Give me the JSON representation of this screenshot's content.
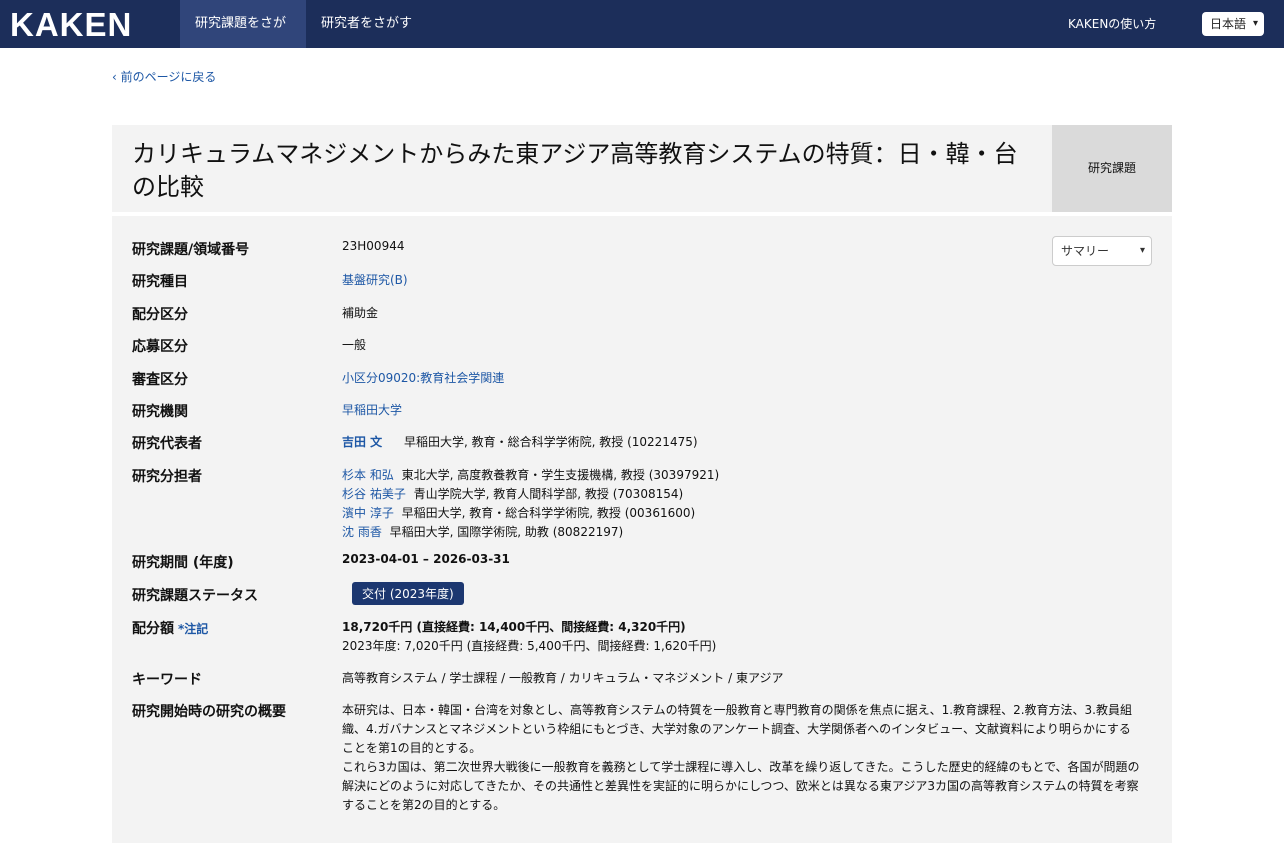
{
  "nav": {
    "logo": "KAKEN",
    "tab_projects": "研究課題をさがす",
    "tab_researchers": "研究者をさがす",
    "help": "KAKENの使い方",
    "language": "日本語"
  },
  "back_link": "前のページに戻る",
  "project": {
    "title": "カリキュラムマネジメントからみた東アジア高等教育システムの特質：日・韓・台の比較",
    "type_label": "研究課題",
    "summary_select": "サマリー"
  },
  "fields": {
    "number_label": "研究課題/領域番号",
    "number_value": "23H00944",
    "category_label": "研究種目",
    "category_value": "基盤研究(B)",
    "allocation_label": "配分区分",
    "allocation_value": "補助金",
    "application_label": "応募区分",
    "application_value": "一般",
    "review_label": "審査区分",
    "review_value": "小区分09020:教育社会学関連",
    "institution_label": "研究機関",
    "institution_value": "早稲田大学",
    "pi_label": "研究代表者",
    "pi_name": "吉田 文",
    "pi_affiliation": "早稲田大学, 教育・総合科学学術院, 教授 (10221475)",
    "coinvestigators_label": "研究分担者",
    "coinvestigators": [
      {
        "name": "杉本 和弘",
        "affiliation": "東北大学, 高度教養教育・学生支援機構, 教授 (30397921)"
      },
      {
        "name": "杉谷 祐美子",
        "affiliation": "青山学院大学, 教育人間科学部, 教授 (70308154)"
      },
      {
        "name": "濱中 淳子",
        "affiliation": "早稲田大学, 教育・総合科学学術院, 教授 (00361600)"
      },
      {
        "name": "沈 雨香",
        "affiliation": "早稲田大学, 国際学術院, 助教 (80822197)"
      }
    ],
    "period_label": "研究期間 (年度)",
    "period_value": "2023-04-01 – 2026-03-31",
    "status_label": "研究課題ステータス",
    "status_value": "交付 (2023年度)",
    "budget_label": "配分額",
    "budget_note": "*注記",
    "budget_total": "18,720千円 (直接経費: 14,400千円、間接経費: 4,320千円)",
    "budget_year": "2023年度: 7,020千円 (直接経費: 5,400千円、間接経費: 1,620千円)",
    "keywords_label": "キーワード",
    "keywords_value": "高等教育システム / 学士課程 / 一般教育 / カリキュラム・マネジメント / 東アジア",
    "outline_label": "研究開始時の研究の概要",
    "outline_p1": "本研究は、日本・韓国・台湾を対象とし、高等教育システムの特質を一般教育と専門教育の関係を焦点に据え、1.教育課程、2.教育方法、3.教員組織、4.ガバナンスとマネジメントという枠組にもとづき、大学対象のアンケート調査、大学関係者へのインタビュー、文献資料により明らかにすることを第1の目的とする。",
    "outline_p2": "これら3カ国は、第二次世界大戦後に一般教育を義務として学士課程に導入し、改革を繰り返してきた。こうした歴史的経緯のもとで、各国が問題の解決にどのように対応してきたか、その共通性と差異性を実証的に明らかにしつつ、欧米とは異なる東アジア3カ国の高等教育システムの特質を考察することを第2の目的とする。"
  }
}
